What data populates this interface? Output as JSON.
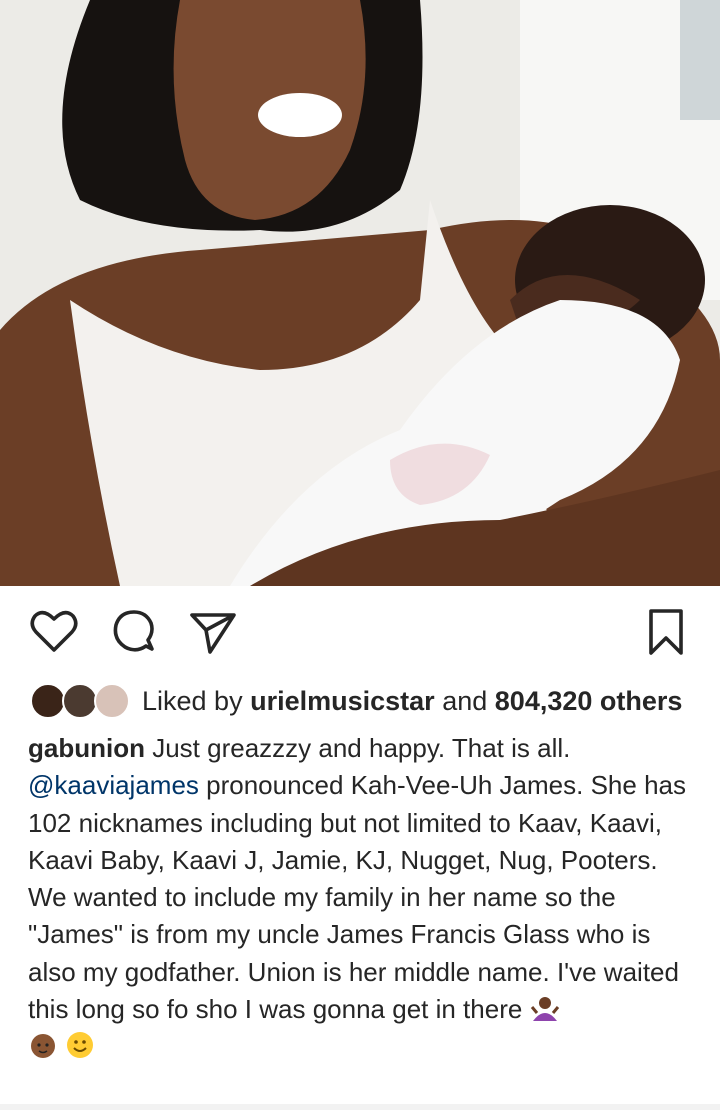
{
  "post": {
    "image_alt": "Smiling woman in a white tank top holding a sleeping newborn wrapped in a white blanket",
    "liked_prefix": "Liked by",
    "liked_user": "urielmusicstar",
    "liked_and": "and",
    "liked_count": "804,320 others",
    "caption_user": "gabunion",
    "caption_line1": " Just greazzzy and happy. That is all.",
    "mention": "@kaaviajames",
    "caption_line2": " pronounced Kah-Vee-Uh James. She has 102 nicknames including but not limited to Kaav, Kaavi, Kaavi Baby, Kaavi J, Jamie, KJ, Nugget, Nug, Pooters.",
    "caption_para2": "We wanted to include my family in her name so the \"James\" is from my uncle James Francis Glass who is also my godfather. Union is her middle name. I've waited this long so fo sho I was gonna get in there "
  },
  "icons": {
    "like": "heart-icon",
    "comment": "comment-icon",
    "share": "paper-plane-icon",
    "save": "bookmark-icon",
    "emoji1": "shrug-emoji",
    "emoji2": "baby-emoji",
    "emoji3": "smiling-face-emoji"
  }
}
